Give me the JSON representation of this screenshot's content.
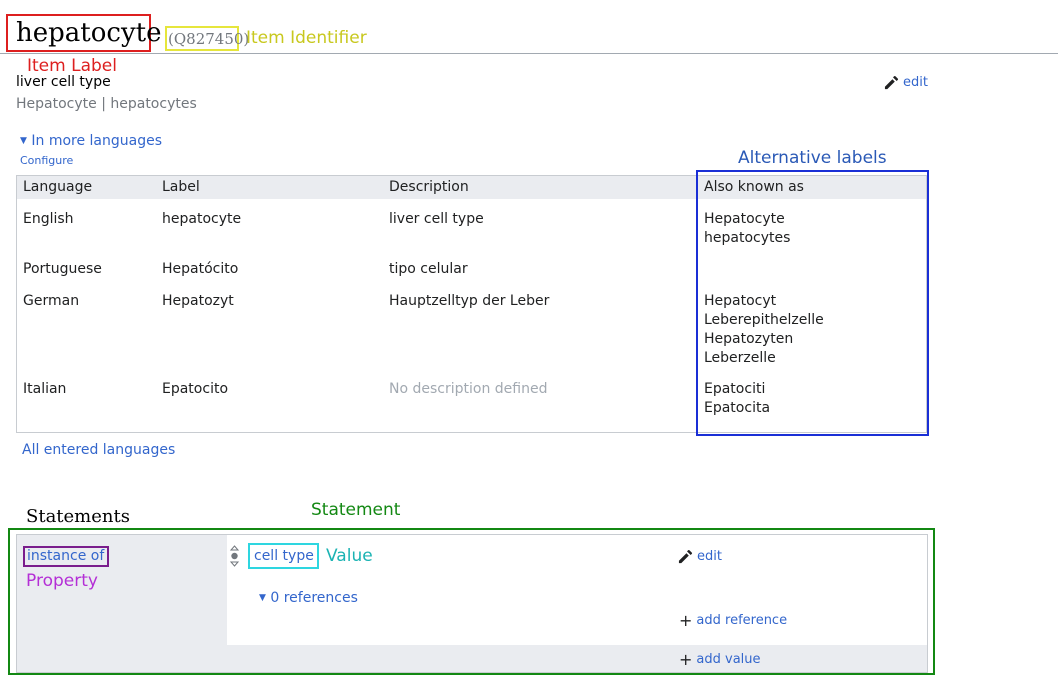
{
  "item": {
    "label": "hepatocyte",
    "id": "(Q827450)",
    "description": "liver cell type",
    "aliases": "Hepatocyte | hepatocytes"
  },
  "annotations": {
    "item_identifier": "Item Identifier",
    "item_label": "Item Label",
    "alternative_labels": "Alternative labels",
    "statement": "Statement",
    "value": "Value",
    "property": "Property"
  },
  "colors": {
    "item_label": "#dd1f1f",
    "item_identifier": "#c8c81e",
    "alternative_labels": "#1a2fd6",
    "statement": "#138813",
    "value": "#1bb3b3",
    "property": "#b42fd6",
    "link": "#3366cc"
  },
  "actions": {
    "edit": "edit",
    "in_more_languages": "In more languages",
    "configure": "Configure",
    "all_languages": "All entered languages",
    "add_reference": "add reference",
    "add_value": "add value"
  },
  "languages_table": {
    "headers": [
      "Language",
      "Label",
      "Description",
      "Also known as"
    ],
    "rows": [
      {
        "language": "English",
        "label": "hepatocyte",
        "description": "liver cell type",
        "aliases": [
          "Hepatocyte",
          "hepatocytes"
        ]
      },
      {
        "language": "Portuguese",
        "label": "Hepatócito",
        "description": "tipo celular",
        "aliases": []
      },
      {
        "language": "German",
        "label": "Hepatozyt",
        "description": "Hauptzelltyp der Leber",
        "aliases": [
          "Hepatocyt",
          "Leberepithelzelle",
          "Hepatozyten",
          "Leberzelle"
        ]
      },
      {
        "language": "Italian",
        "label": "Epatocito",
        "description": "No description defined",
        "aliases": [
          "Epatociti",
          "Epatocita"
        ]
      }
    ]
  },
  "statements": {
    "heading": "Statements",
    "items": [
      {
        "property": "instance of",
        "value": "cell type",
        "references": "0 references"
      }
    ]
  }
}
